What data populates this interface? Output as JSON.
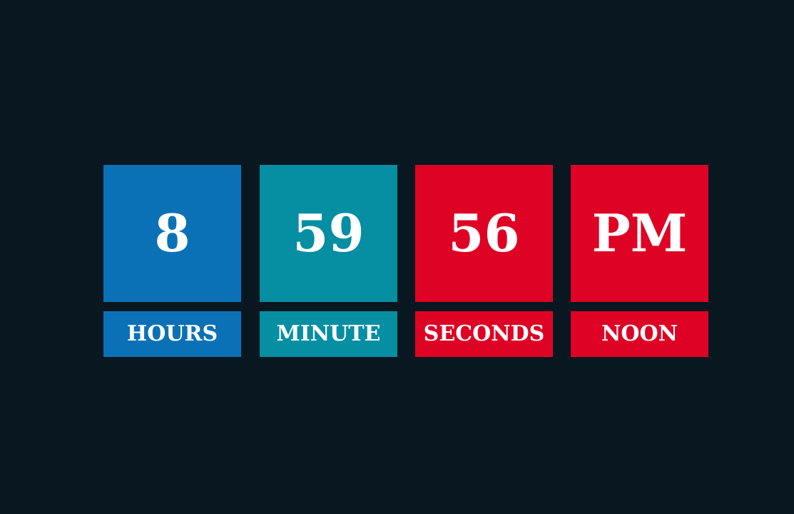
{
  "colors": {
    "background": "#081720",
    "hours": "#0b71b6",
    "minute": "#068ea3",
    "seconds": "#de0324",
    "noon": "#de0324",
    "text": "#ffffff"
  },
  "clock": {
    "hours": {
      "value": "8",
      "label": "HOURS"
    },
    "minute": {
      "value": "59",
      "label": "MINUTE"
    },
    "seconds": {
      "value": "56",
      "label": "SECONDS"
    },
    "noon": {
      "value": "PM",
      "label": "NOON"
    }
  }
}
